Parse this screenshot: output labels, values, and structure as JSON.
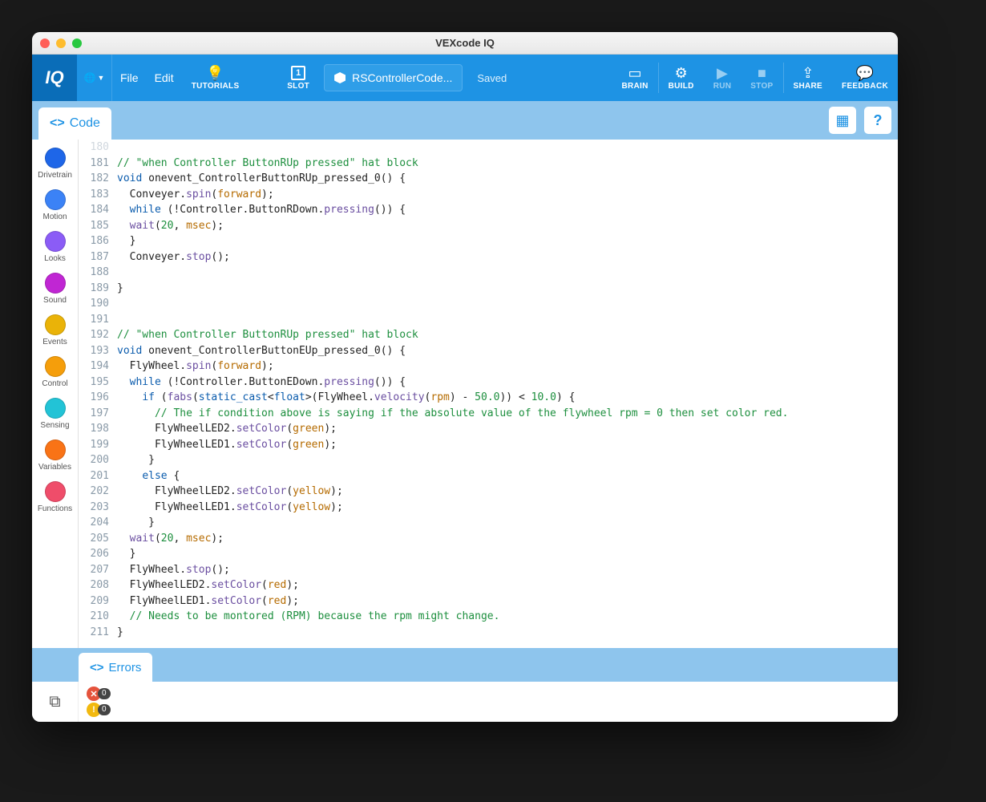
{
  "window": {
    "title": "VEXcode IQ"
  },
  "toolbar": {
    "logo": "IQ",
    "file": "File",
    "edit": "Edit",
    "tutorials": "TUTORIALS",
    "slot": "SLOT",
    "slot_num": "1",
    "filename": "RSControllerCode...",
    "saved": "Saved",
    "brain": "BRAIN",
    "build": "BUILD",
    "run": "RUN",
    "stop": "STOP",
    "share": "SHARE",
    "feedback": "FEEDBACK"
  },
  "subbar": {
    "code_tab": "Code"
  },
  "palette": [
    {
      "label": "Drivetrain",
      "color": "#1e66e8"
    },
    {
      "label": "Motion",
      "color": "#3b82f6"
    },
    {
      "label": "Looks",
      "color": "#8b5cf6"
    },
    {
      "label": "Sound",
      "color": "#c026d3"
    },
    {
      "label": "Events",
      "color": "#eab308"
    },
    {
      "label": "Control",
      "color": "#f59e0b"
    },
    {
      "label": "Sensing",
      "color": "#22c3d6"
    },
    {
      "label": "Variables",
      "color": "#f97316"
    },
    {
      "label": "Functions",
      "color": "#ef4d6a"
    }
  ],
  "code": {
    "first_line": 180,
    "lines": [
      "",
      "// \"when Controller ButtonRUp pressed\" hat block",
      "void onevent_ControllerButtonRUp_pressed_0() {",
      "  Conveyer.spin(forward);",
      "  while (!Controller.ButtonRDown.pressing()) {",
      "  wait(20, msec);",
      "  }",
      "  Conveyer.stop();",
      "",
      "}",
      "",
      "",
      "// \"when Controller ButtonRUp pressed\" hat block",
      "void onevent_ControllerButtonEUp_pressed_0() {",
      "  FlyWheel.spin(forward);",
      "  while (!Controller.ButtonEDown.pressing()) {",
      "    if (fabs(static_cast<float>(FlyWheel.velocity(rpm) - 50.0)) < 10.0) {",
      "      // The if condition above is saying if the absolute value of the flywheel rpm = 0 then set color red.",
      "      FlyWheelLED2.setColor(green);",
      "      FlyWheelLED1.setColor(green);",
      "     }",
      "    else {",
      "      FlyWheelLED2.setColor(yellow);",
      "      FlyWheelLED1.setColor(yellow);",
      "     }",
      "  wait(20, msec);",
      "  }",
      "  FlyWheel.stop();",
      "  FlyWheelLED2.setColor(red);",
      "  FlyWheelLED1.setColor(red);",
      "  // Needs to be montored (RPM) because the rpm might change.",
      "}"
    ]
  },
  "errors": {
    "tab": "Errors",
    "error_count": "0",
    "warning_count": "0"
  }
}
